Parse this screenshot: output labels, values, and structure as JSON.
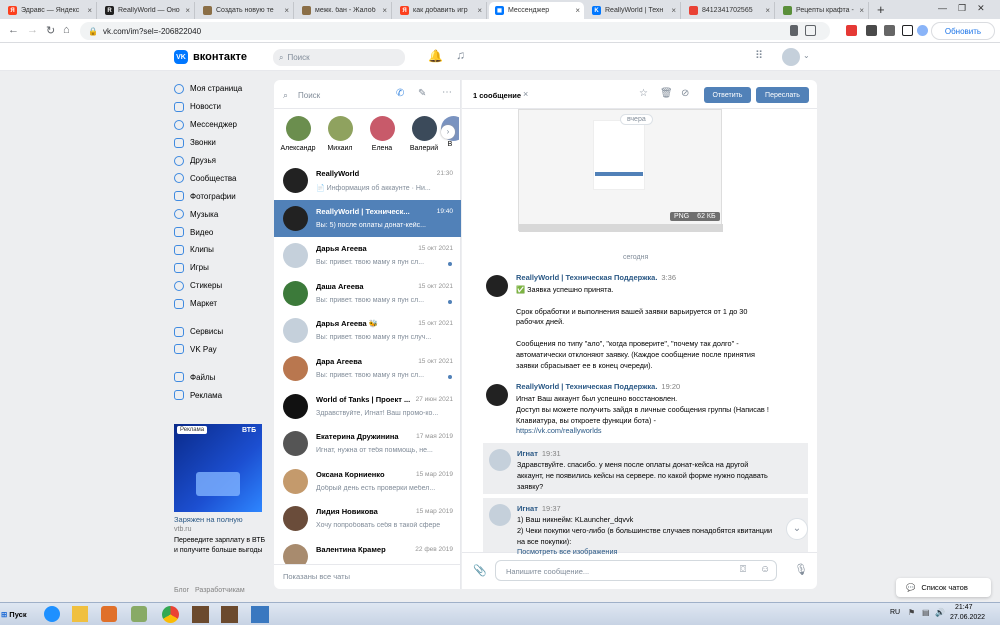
{
  "browser": {
    "tabs": [
      {
        "label": "Эдравс — Яндекс",
        "color": "#fc3f1d"
      },
      {
        "label": "ReallyWorld — Оно",
        "color": "#1f1f1f"
      },
      {
        "label": "Создать новую те",
        "color": "#8b6f47"
      },
      {
        "label": "межк. бан - Жалоб",
        "color": "#8b6f47"
      },
      {
        "label": "как добавить игр",
        "color": "#fc3f1d"
      },
      {
        "label": "Мессенджер",
        "color": "#0077ff"
      },
      {
        "label": "ReallyWorld | Техн",
        "color": "#0077ff"
      },
      {
        "label": "8412341702565",
        "color": "#e94235"
      },
      {
        "label": "Рецепты крафта -",
        "color": "#5a8f3a"
      }
    ],
    "url": "vk.com/im?sel=-206822040",
    "update_label": "Обновить"
  },
  "vk": {
    "logo": "вконтакте",
    "search_placeholder": "Поиск",
    "menu": [
      "Моя страница",
      "Новости",
      "Мессенджер",
      "Звонки",
      "Друзья",
      "Сообщества",
      "Фотографии",
      "Музыка",
      "Видео",
      "Клипы",
      "Игры",
      "Стикеры",
      "Маркет"
    ],
    "menu2": [
      "Сервисы",
      "VK Pay"
    ],
    "menu3": [
      "Файлы",
      "Реклама"
    ],
    "promo": {
      "tag": "Реклама",
      "title": "Заряжен на полную",
      "domain": "vtb.ru",
      "text": "Переведите зарплату в ВТБ и получите больше выгоды",
      "brand": "ВТБ"
    },
    "footer": "Блог   Разработчикам"
  },
  "convlist": {
    "search_placeholder": "Поиск",
    "stories": [
      "Александр",
      "Михаил",
      "Елена",
      "Валерий",
      "В"
    ],
    "conversations": [
      {
        "name": "ReallyWorld",
        "date": "21:30",
        "preview": "📄 Информация об аккаунте · Ни..."
      },
      {
        "name": "ReallyWorld | Техническ...",
        "date": "19:40",
        "preview": "Вы: 5) после оплаты донат-кейс..."
      },
      {
        "name": "Дарья Агеева",
        "date": "15 окт 2021",
        "preview": "Вы: привет. твою маму я пун сл..."
      },
      {
        "name": "Даша Агеева",
        "date": "15 окт 2021",
        "preview": "Вы: привет. твою маму я пун сл..."
      },
      {
        "name": "Дарья Агеева 🐝",
        "date": "15 окт 2021",
        "preview": "Вы: привет. твою маму я пун случ..."
      },
      {
        "name": "Дара Агеева",
        "date": "15 окт 2021",
        "preview": "Вы: привет. твою маму я пун сл..."
      },
      {
        "name": "World of Tanks | Проект ...",
        "date": "27 июн 2021",
        "preview": "Здравствуйте, Игнат! Ваш промо-ко..."
      },
      {
        "name": "Екатерина Дружинина",
        "date": "17 мая 2019",
        "preview": "Игнат, нужна от тебя поммощь, не..."
      },
      {
        "name": "Оксана Корниенко",
        "date": "15 мар 2019",
        "preview": "Добрый день есть проверки мебел..."
      },
      {
        "name": "Лидия Новикова",
        "date": "15 мар 2019",
        "preview": "Хочу попробовать себя в такой сфере"
      },
      {
        "name": "Валентина Крамер",
        "date": "22 фев 2019",
        "preview": ""
      }
    ],
    "hidden_chats": "Показаны все чаты"
  },
  "chat": {
    "selected": "1 сообщение",
    "reply": "Ответить",
    "forward": "Переслать",
    "yesterday": "вчера",
    "file_type": "PNG",
    "file_size": "62 КБ",
    "today": "сегодня",
    "messages": [
      {
        "name": "ReallyWorld | Техническая Поддержка.",
        "time": "3:36",
        "lines": [
          "✅ Заявка успешно принята.",
          "",
          "Срок обработки и выполнения вашей заявки варьируется от 1 до 30 рабочих дней.",
          "",
          "Сообщения по типу \"ало\", \"когда проверите\", \"почему так долго\" - автоматически отклоняют заявку. (Каждое сообщение после принятия заявки сбрасывает ее в конец очереди)."
        ]
      },
      {
        "name": "ReallyWorld | Техническая Поддержка.",
        "time": "19:20",
        "lines": [
          "Игнат Ваш аккаунт был успешно восстановлен.",
          "Доступ вы можете получить зайдя в личные сообщения группы (Написав !Клавиатура, вы откроете функции бота) -",
          "https://vk.com/reallyworlds"
        ]
      },
      {
        "name": "Игнат",
        "time": "19:31",
        "lines": [
          "Здравствуйте. спасибо. у меня после оплаты донат-кейса на другой аккаунт, не появились кейсы на сервере. по какой форме нужно подавать заявку?"
        ]
      },
      {
        "name": "Игнат",
        "time": "19:37",
        "lines": [
          "1) Ваш никнейм: KLauncher_dqvvk",
          "2) Чеки покупки чего-либо (в большинстве случаев понадобятся квитанции на все покупки):",
          "Посмотреть все изображения"
        ]
      }
    ],
    "input_placeholder": "Напишите сообщение...",
    "chats_list": "Список чатов"
  },
  "taskbar": {
    "start": "Пуск",
    "lang": "RU",
    "time": "21:47",
    "date": "27.06.2022"
  }
}
